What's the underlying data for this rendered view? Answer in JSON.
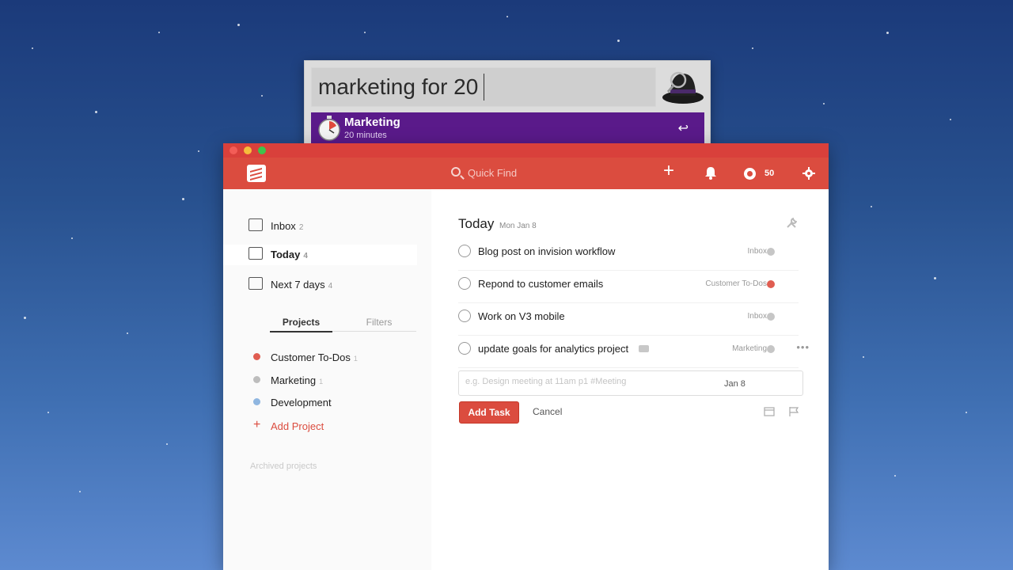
{
  "alfred": {
    "query": "marketing for 20",
    "result": {
      "title": "Marketing",
      "subtitle": "20 minutes",
      "enter_glyph": "↩"
    }
  },
  "topbar": {
    "quick_find_placeholder": "Quick Find",
    "karma": "50"
  },
  "sidebar": {
    "nav": [
      {
        "label": "Inbox",
        "count": "2"
      },
      {
        "label": "Today",
        "count": "4"
      },
      {
        "label": "Next 7 days",
        "count": "4"
      }
    ],
    "tabs": {
      "projects": "Projects",
      "filters": "Filters"
    },
    "projects": [
      {
        "label": "Customer To-Dos",
        "count": "1",
        "color": "#e05d51"
      },
      {
        "label": "Marketing",
        "count": "1",
        "color": "#bdbdbd"
      },
      {
        "label": "Development",
        "count": "",
        "color": "#8fb6e0"
      }
    ],
    "add_project": "Add Project",
    "archived": "Archived projects"
  },
  "main": {
    "title": "Today",
    "date": "Mon Jan 8",
    "tasks": [
      {
        "name": "Blog post on invision workflow",
        "project": "Inbox",
        "color": "#c6c6c6"
      },
      {
        "name": "Repond to customer emails",
        "project": "Customer To-Dos",
        "color": "#e05d51"
      },
      {
        "name": "Work on V3 mobile",
        "project": "Inbox",
        "color": "#c6c6c6"
      },
      {
        "name": "update goals for analytics project",
        "project": "Marketing",
        "color": "#c6c6c6"
      }
    ],
    "editor": {
      "placeholder": "e.g. Design meeting at 11am p1 #Meeting",
      "due": "Jan 8",
      "add_label": "Add Task",
      "cancel_label": "Cancel"
    }
  }
}
